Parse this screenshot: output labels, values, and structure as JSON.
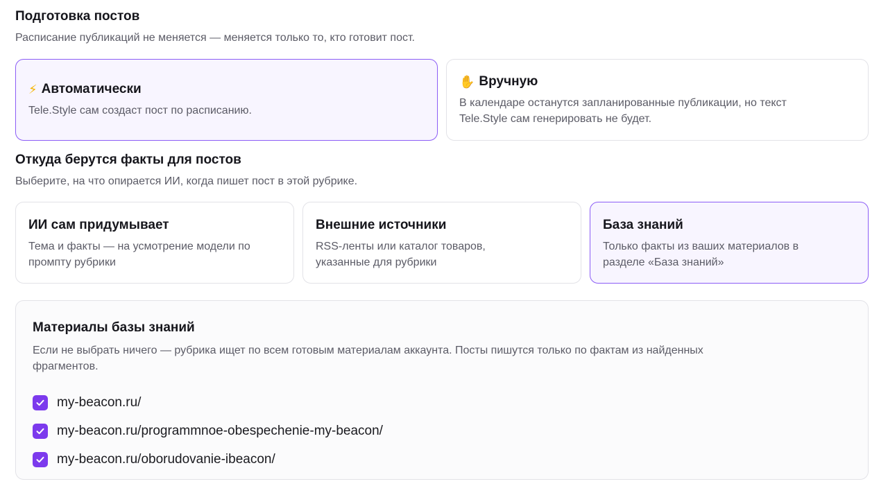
{
  "prep": {
    "title": "Подготовка постов",
    "desc": "Расписание публикаций не меняется — меняется только то, кто готовит пост.",
    "options": [
      {
        "icon": "⚡",
        "title": "Автоматически",
        "desc": "Tele.Style сам создаст пост по расписанию.",
        "selected": true
      },
      {
        "icon": "✋",
        "title": "Вручную",
        "desc_lines": [
          "В календаре останутся запланированные публикации, но текст",
          "Tele.Style сам генерировать не будет."
        ],
        "selected": false
      }
    ]
  },
  "sources": {
    "title": "Откуда берутся факты для постов",
    "desc": "Выберите, на что опирается ИИ, когда пишет пост в этой рубрике.",
    "options": [
      {
        "title": "ИИ сам придумывает",
        "desc_lines": [
          "Тема и факты — на усмотрение модели по",
          "промпту рубрики"
        ],
        "selected": false
      },
      {
        "title": "Внешние источники",
        "desc_lines": [
          "RSS-ленты или каталог товаров,",
          "указанные для рубрики"
        ],
        "selected": false
      },
      {
        "title": "База знаний",
        "desc_lines": [
          "Только факты из ваших материалов в",
          "разделе «База знаний»"
        ],
        "selected": true
      }
    ]
  },
  "kb": {
    "title": "Материалы базы знаний",
    "desc_lines": [
      "Если не выбрать ничего — рубрика ищет по всем готовым материалам аккаунта. Посты пишутся только по фактам из найденных",
      "фрагментов."
    ],
    "items": [
      {
        "label": "my-beacon.ru/",
        "checked": true
      },
      {
        "label": "my-beacon.ru/programmnoe-obespechenie-my-beacon/",
        "checked": true
      },
      {
        "label": "my-beacon.ru/oborudovanie-ibeacon/",
        "checked": true
      }
    ]
  },
  "colors": {
    "accent": "#7c3aed",
    "selected_border": "#8b5cf6",
    "selected_bg": "#f8f5ff"
  }
}
